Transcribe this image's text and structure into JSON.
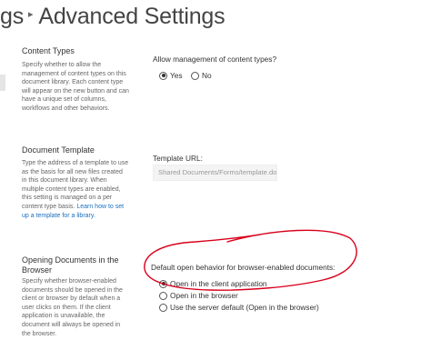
{
  "header": {
    "breadcrumb_parent": "gs",
    "separator": "▸",
    "title": "Advanced Settings"
  },
  "content_types": {
    "title": "Content Types",
    "description": "Specify whether to allow the management of content types on this document library. Each content type will appear on the new button and can have a unique set of columns, workflows and other behaviors.",
    "question": "Allow management of content types?",
    "options": [
      {
        "label": "Yes",
        "checked": true
      },
      {
        "label": "No",
        "checked": false
      }
    ]
  },
  "document_template": {
    "title": "Document Template",
    "description": "Type the address of a template to use as the basis for all new files created in this document library. When multiple content types are enabled, this setting is managed on a per content type basis. ",
    "link_text": "Learn how to set up a template for a library.",
    "url_label": "Template URL:",
    "url_value": "Shared Documents/Forms/template.dotx"
  },
  "opening_documents": {
    "title": "Opening Documents in the Browser",
    "description": "Specify whether browser-enabled documents should be opened in the client or browser by default when a user clicks on them. If the client application is unavailable, the document will always be opened in the browser.",
    "question": "Default open behavior for browser-enabled documents:",
    "options": [
      {
        "label": "Open in the client application",
        "checked": true
      },
      {
        "label": "Open in the browser",
        "checked": false
      },
      {
        "label": "Use the server default (Open in the browser)",
        "checked": false
      }
    ]
  },
  "colors": {
    "link": "#1a6fbf",
    "annotation": "#d9001b",
    "text": "#333333",
    "muted": "#666666"
  }
}
